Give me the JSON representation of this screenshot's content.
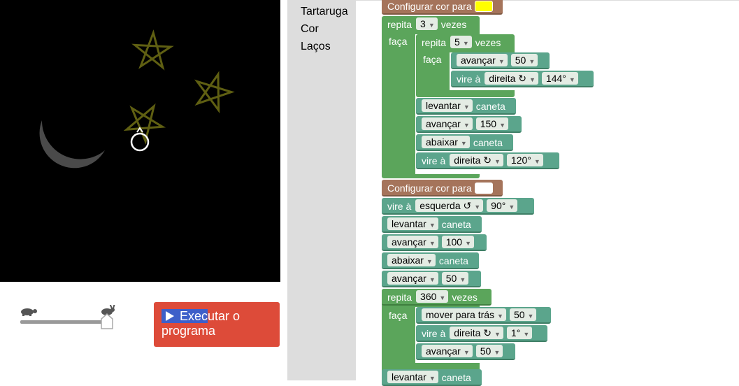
{
  "run_button": {
    "label_selected": "Exec",
    "label_rest": "utar o programa"
  },
  "toolbox": {
    "categories": [
      "Tartaruga",
      "Cor",
      "Laços"
    ]
  },
  "colors": {
    "yellow": "#ffff00",
    "white": "#ffffff",
    "run_button": "#dd4b39",
    "loop_block": "#5ba55b",
    "turtle_block": "#5ba58c",
    "color_block": "#a5745b"
  },
  "blocks": {
    "set_color_1": {
      "text": "Configurar cor para",
      "color": "#ffff00"
    },
    "repeat_outer": {
      "repita": "repita",
      "count": "3",
      "vezes": "vezes",
      "faca": "faça"
    },
    "repeat_inner": {
      "repita": "repita",
      "count": "5",
      "vezes": "vezes",
      "faca": "faça"
    },
    "advance_50a": {
      "dir": "avançar",
      "value": "50"
    },
    "turn_144": {
      "prefix": "vire à",
      "dir": "direita ↻",
      "angle": "144°"
    },
    "penup_1": {
      "action": "levantar",
      "suffix": "caneta"
    },
    "advance_150": {
      "dir": "avançar",
      "value": "150"
    },
    "pendown_1": {
      "action": "abaixar",
      "suffix": "caneta"
    },
    "turn_120": {
      "prefix": "vire à",
      "dir": "direita ↻",
      "angle": "120°"
    },
    "set_color_2": {
      "text": "Configurar cor para",
      "color": "#ffffff"
    },
    "turn_left_90": {
      "prefix": "vire à",
      "dir": "esquerda ↺",
      "angle": "90°"
    },
    "penup_2": {
      "action": "levantar",
      "suffix": "caneta"
    },
    "advance_100": {
      "dir": "avançar",
      "value": "100"
    },
    "pendown_2": {
      "action": "abaixar",
      "suffix": "caneta"
    },
    "advance_50b": {
      "dir": "avançar",
      "value": "50"
    },
    "repeat_360": {
      "repita": "repita",
      "count": "360",
      "vezes": "vezes",
      "faca": "faça"
    },
    "move_back": {
      "dir": "mover para trás",
      "value": "50"
    },
    "turn_1": {
      "prefix": "vire à",
      "dir": "direita ↻",
      "angle": "1°"
    },
    "advance_50c": {
      "dir": "avançar",
      "value": "50"
    },
    "penup_3": {
      "action": "levantar",
      "suffix": "caneta"
    }
  }
}
